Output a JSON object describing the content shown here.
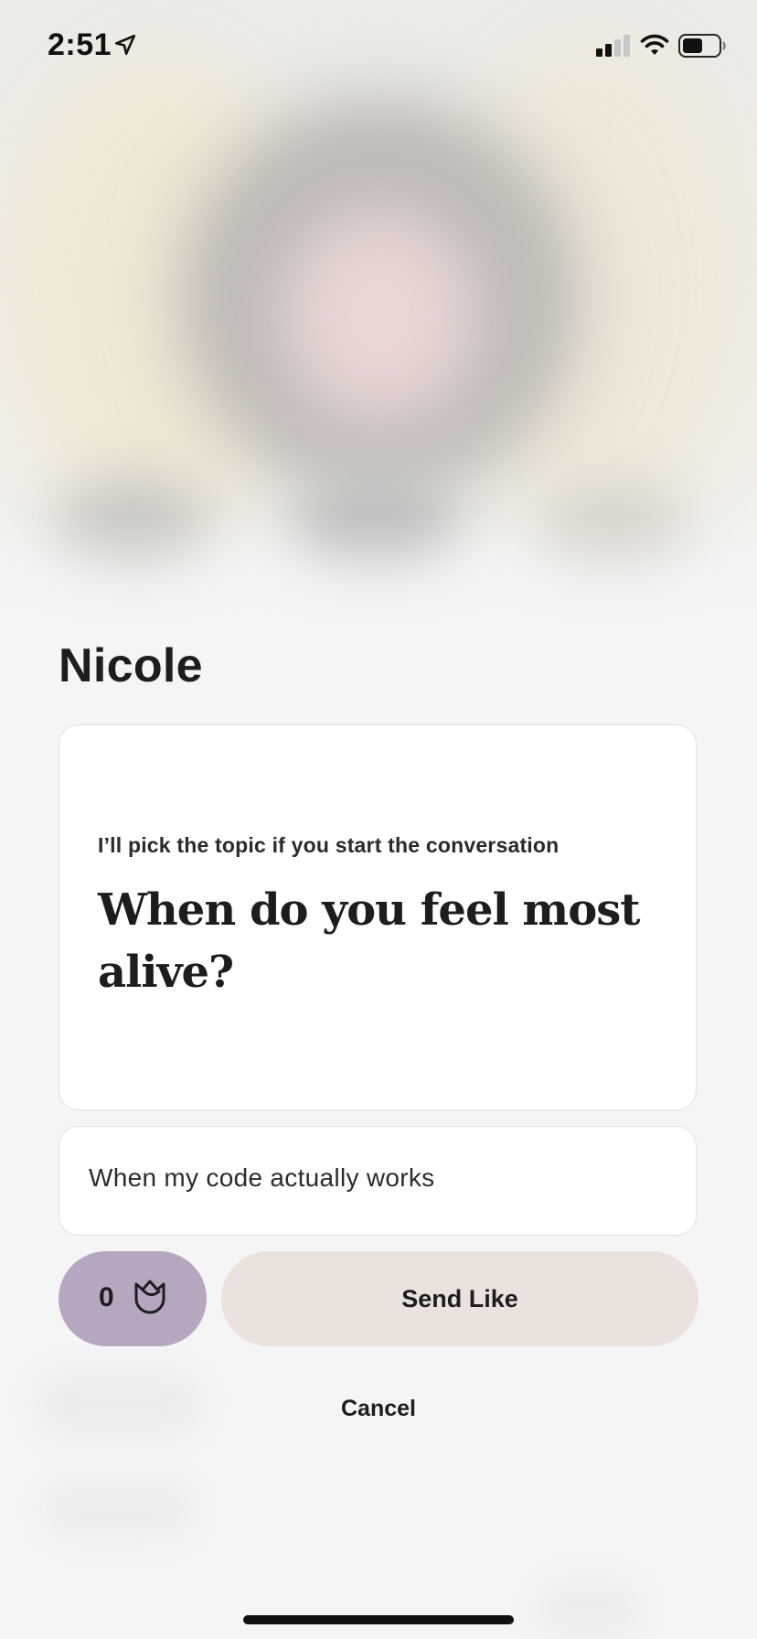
{
  "status_bar": {
    "time": "2:51",
    "icons": [
      "location-arrow-icon",
      "cell-signal-icon",
      "wifi-icon",
      "battery-icon"
    ]
  },
  "profile": {
    "name": "Nicole"
  },
  "prompt": {
    "kicker": "I’ll pick the topic if you start the conversation",
    "question": "When do you feel most alive?"
  },
  "comment": {
    "value": "When my code actually works"
  },
  "actions": {
    "rose_count": "0",
    "send_like_label": "Send Like",
    "cancel_label": "Cancel"
  },
  "colors": {
    "rose_button_bg": "#b7a6c0",
    "send_like_bg": "#ebe2de",
    "page_bg": "#f5f5f6"
  }
}
